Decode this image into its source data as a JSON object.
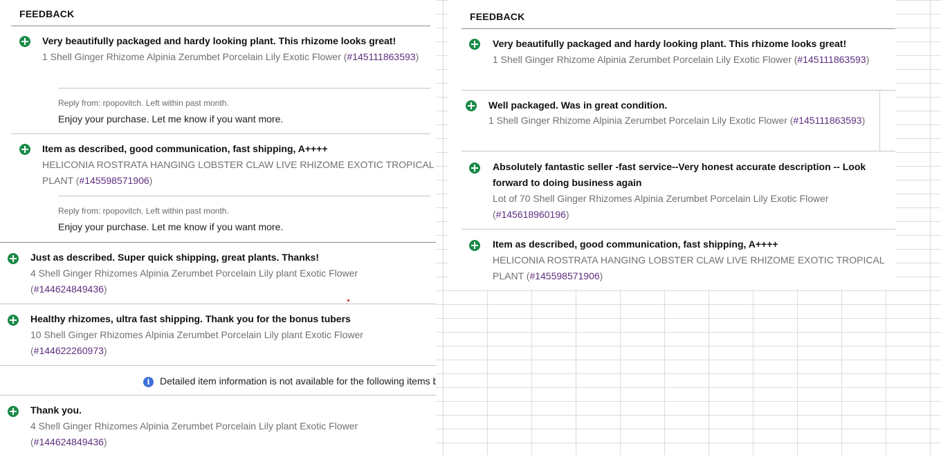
{
  "left": {
    "header": "FEEDBACK",
    "entries": [
      {
        "title": "Very beautifully packaged and hardy looking plant. This rhizome looks great!",
        "item_prefix": "1 Shell Ginger Rhizome Alpinia Zerumbet Porcelain Lily Exotic Flower (",
        "item_number": "#145111863593",
        "item_suffix": ")",
        "reply_from": "Reply from: rpopovitch. Left within past month.",
        "reply_text": "Enjoy your purchase. Let me know if you want more."
      },
      {
        "title": "Item as described, good communication, fast shipping, A++++",
        "item_line1": "HELICONIA ROSTRATA HANGING LOBSTER CLAW LIVE RHIZOME EXOTIC TROPICAL",
        "item_prefix2": "PLANT (",
        "item_number": "#145598571906",
        "item_suffix": ")",
        "reply_from": "Reply from: rpopovitch. Left within past month.",
        "reply_text": "Enjoy your purchase. Let me know if you want more."
      },
      {
        "title": "Just as described. Super quick shipping, great plants. Thanks!",
        "item_line1": "4 Shell Ginger Rhizomes Alpinia Zerumbet Porcelain Lily plant Exotic Flower",
        "item_prefix2": "(",
        "item_number": "#144624849436",
        "item_suffix": ")"
      },
      {
        "title": "Healthy rhizomes, ultra fast shipping. Thank you for the bonus tubers",
        "item_line1": "10 Shell Ginger Rhizomes Alpinia Zerumbet Porcelain Lily plant Exotic Flower",
        "item_prefix2": "(",
        "item_number": "#144622260973",
        "item_suffix": ")"
      },
      {
        "title": "Thank you.",
        "item_line1": "4 Shell Ginger Rhizomes Alpinia Zerumbet Porcelain Lily plant Exotic Flower",
        "item_prefix2": "(",
        "item_number": "#144624849436",
        "item_suffix": ")"
      }
    ],
    "info_notice": "Detailed item information is not available for the following items b"
  },
  "right": {
    "header": "FEEDBACK",
    "entries": [
      {
        "title": "Very beautifully packaged and hardy looking plant. This rhizome looks great!",
        "item_prefix": "1 Shell Ginger Rhizome Alpinia Zerumbet Porcelain Lily Exotic Flower (",
        "item_number": "#145111863593",
        "item_suffix": ")"
      },
      {
        "title": "Well packaged. Was in great condition.",
        "item_prefix": "1 Shell Ginger Rhizome Alpinia Zerumbet Porcelain Lily Exotic Flower (",
        "item_number": "#145111863593",
        "item_suffix": ")"
      },
      {
        "title_line1": "Absolutely fantastic seller -fast service--Very honest accurate description -- Look",
        "title_line2": "forward to doing business again",
        "item_line1": "Lot of 70 Shell Ginger Rhizomes Alpinia Zerumbet Porcelain Lily Exotic Flower",
        "item_prefix2": "(",
        "item_number": "#145618960196",
        "item_suffix": ")"
      },
      {
        "title": "Item as described, good communication, fast shipping, A++++",
        "item_line1": "HELICONIA ROSTRATA HANGING LOBSTER CLAW LIVE RHIZOME EXOTIC TROPICAL",
        "item_prefix2": "PLANT (",
        "item_number": "#145598571906",
        "item_suffix": ")"
      }
    ]
  },
  "colors": {
    "positive_icon": "#1b8a47",
    "item_link": "#5d2d7e",
    "info_icon": "#3d6fd9",
    "grid": "#dcdcdc"
  }
}
